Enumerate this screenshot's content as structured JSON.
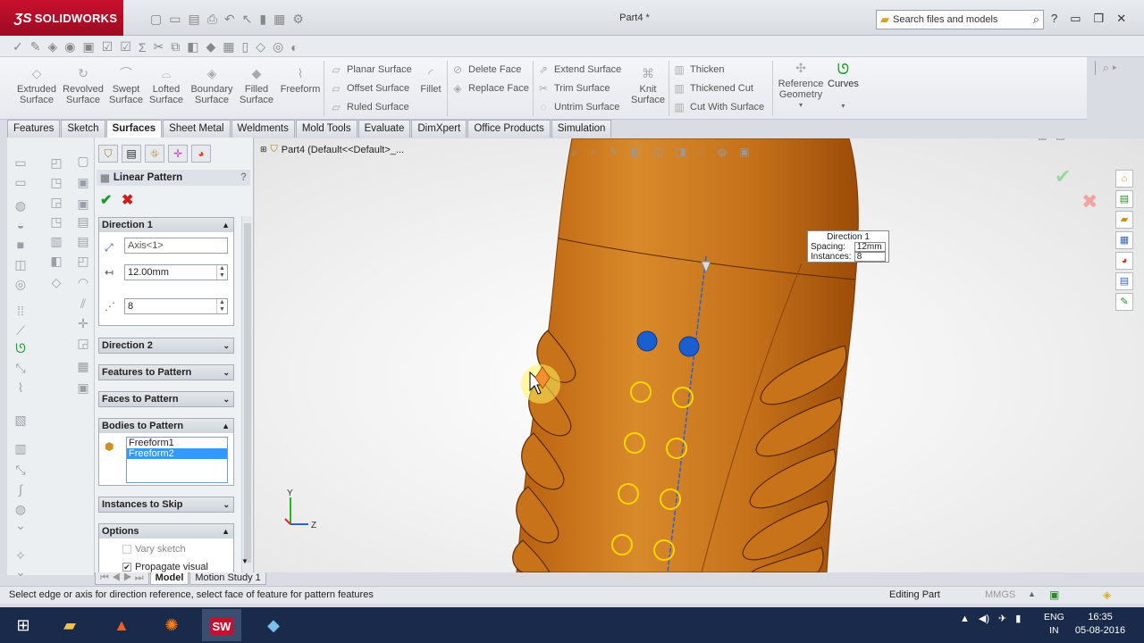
{
  "app": {
    "logo_text": "SOLIDWORKS",
    "doc_title": "Part4 *"
  },
  "search": {
    "placeholder": "Search files and models"
  },
  "ribbon": {
    "extruded_surface": "Extruded Surface",
    "revolved_surface": "Revolved Surface",
    "swept_surface": "Swept Surface",
    "lofted_surface": "Lofted Surface",
    "boundary_surface": "Boundary Surface",
    "filled_surface": "Filled Surface",
    "freeform": "Freeform",
    "planar_surface": "Planar Surface",
    "offset_surface": "Offset Surface",
    "ruled_surface": "Ruled Surface",
    "fillet": "Fillet",
    "delete_face": "Delete Face",
    "replace_face": "Replace Face",
    "extend_surface": "Extend Surface",
    "trim_surface": "Trim Surface",
    "untrim_surface": "Untrim Surface",
    "knit_surface": "Knit Surface",
    "thicken": "Thicken",
    "thickened_cut": "Thickened Cut",
    "cut_with_surface": "Cut With Surface",
    "reference_geometry": "Reference Geometry",
    "curves": "Curves"
  },
  "tabs": [
    "Features",
    "Sketch",
    "Surfaces",
    "Sheet Metal",
    "Weldments",
    "Mold Tools",
    "Evaluate",
    "DimXpert",
    "Office Products",
    "Simulation"
  ],
  "active_tab": "Surfaces",
  "property_manager": {
    "title": "Linear Pattern",
    "direction1": {
      "header": "Direction 1",
      "axis_value": "Axis<1>",
      "spacing_value": "12.00mm",
      "instances_value": "8"
    },
    "direction2_header": "Direction 2",
    "features_header": "Features to Pattern",
    "faces_header": "Faces to Pattern",
    "bodies": {
      "header": "Bodies to Pattern",
      "items": [
        "Freeform1",
        "Freeform2"
      ],
      "selected": "Freeform2"
    },
    "skip_header": "Instances to Skip",
    "options": {
      "header": "Options",
      "vary_sketch": "Vary sketch",
      "propagate_visual": "Propagate visual",
      "vary_sketch_checked": false,
      "propagate_visual_checked": true
    }
  },
  "bottom_tabs": [
    "Model",
    "Motion Study 1"
  ],
  "active_bottom_tab": "Model",
  "tree_root": "Part4  (Default<<Default>_...",
  "callout": {
    "title": "Direction 1",
    "spacing_label": "Spacing:",
    "spacing_value": "12mm",
    "instances_label": "Instances:",
    "instances_value": "8"
  },
  "triad": {
    "y_label": "Y",
    "z_label": "Z"
  },
  "status": {
    "message": "Select edge or axis for direction reference, select face of feature for pattern features",
    "mode": "Editing Part",
    "units": "MMGS"
  },
  "taskbar": {
    "lang_line1": "ENG",
    "lang_line2": "IN",
    "time": "16:35",
    "date": "05-08-2016"
  },
  "colors": {
    "accent_red": "#c8102e",
    "body_orange": "#c8731a",
    "pattern_blue": "#1a5fd0",
    "preview_yellow": "#ffd800"
  }
}
